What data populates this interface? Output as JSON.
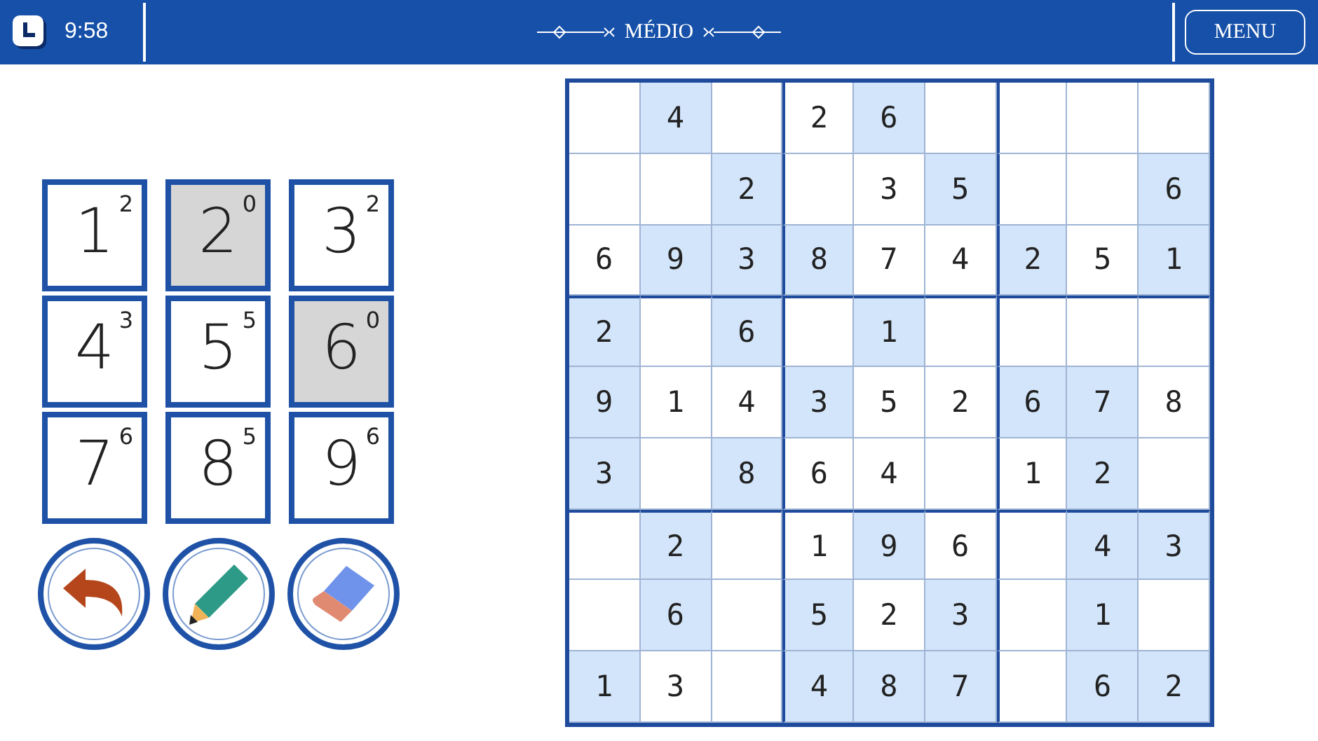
{
  "header": {
    "time": "9:58",
    "difficulty": "MÉDIO",
    "menu_button": "MENU"
  },
  "keypad": [
    {
      "digit": "1",
      "count": "2",
      "disabled": false
    },
    {
      "digit": "2",
      "count": "0",
      "disabled": true
    },
    {
      "digit": "3",
      "count": "2",
      "disabled": false
    },
    {
      "digit": "4",
      "count": "3",
      "disabled": false
    },
    {
      "digit": "5",
      "count": "5",
      "disabled": false
    },
    {
      "digit": "6",
      "count": "0",
      "disabled": true
    },
    {
      "digit": "7",
      "count": "6",
      "disabled": false
    },
    {
      "digit": "8",
      "count": "5",
      "disabled": false
    },
    {
      "digit": "9",
      "count": "6",
      "disabled": false
    }
  ],
  "tools": [
    {
      "kind": "undo"
    },
    {
      "kind": "pencil"
    },
    {
      "kind": "eraser"
    }
  ],
  "grid": [
    [
      {
        "shaded": false
      },
      {
        "value": "4",
        "shaded": true
      },
      {
        "shaded": false
      },
      {
        "value": "2",
        "shaded": false
      },
      {
        "value": "6",
        "shaded": true
      },
      {
        "shaded": false
      },
      {
        "shaded": false
      },
      {
        "shaded": false
      },
      {
        "shaded": false
      }
    ],
    [
      {
        "shaded": false
      },
      {
        "shaded": false
      },
      {
        "value": "2",
        "shaded": true
      },
      {
        "shaded": false
      },
      {
        "value": "3",
        "shaded": false
      },
      {
        "value": "5",
        "shaded": true
      },
      {
        "shaded": false
      },
      {
        "shaded": false
      },
      {
        "value": "6",
        "shaded": true
      }
    ],
    [
      {
        "value": "6",
        "shaded": false
      },
      {
        "value": "9",
        "shaded": true
      },
      {
        "value": "3",
        "shaded": true
      },
      {
        "value": "8",
        "shaded": true
      },
      {
        "value": "7",
        "shaded": false
      },
      {
        "value": "4",
        "shaded": false
      },
      {
        "value": "2",
        "shaded": true
      },
      {
        "value": "5",
        "shaded": false
      },
      {
        "value": "1",
        "shaded": true
      }
    ],
    [
      {
        "value": "2",
        "shaded": true
      },
      {
        "shaded": false
      },
      {
        "value": "6",
        "shaded": true
      },
      {
        "shaded": false
      },
      {
        "value": "1",
        "shaded": true
      },
      {
        "shaded": false
      },
      {
        "shaded": false
      },
      {
        "shaded": false
      },
      {
        "shaded": false
      }
    ],
    [
      {
        "value": "9",
        "shaded": true
      },
      {
        "value": "1",
        "shaded": false
      },
      {
        "value": "4",
        "shaded": false
      },
      {
        "value": "3",
        "shaded": true
      },
      {
        "value": "5",
        "shaded": false
      },
      {
        "value": "2",
        "shaded": false
      },
      {
        "value": "6",
        "shaded": true
      },
      {
        "value": "7",
        "shaded": true
      },
      {
        "value": "8",
        "shaded": false
      }
    ],
    [
      {
        "value": "3",
        "shaded": true
      },
      {
        "shaded": false
      },
      {
        "value": "8",
        "shaded": true
      },
      {
        "value": "6",
        "shaded": false
      },
      {
        "value": "4",
        "shaded": false
      },
      {
        "shaded": false
      },
      {
        "value": "1",
        "shaded": false
      },
      {
        "value": "2",
        "shaded": true
      },
      {
        "shaded": false
      }
    ],
    [
      {
        "shaded": false
      },
      {
        "value": "2",
        "shaded": true
      },
      {
        "shaded": false
      },
      {
        "value": "1",
        "shaded": false
      },
      {
        "value": "9",
        "shaded": true
      },
      {
        "value": "6",
        "shaded": false
      },
      {
        "shaded": false
      },
      {
        "value": "4",
        "shaded": true
      },
      {
        "value": "3",
        "shaded": true
      }
    ],
    [
      {
        "shaded": false
      },
      {
        "value": "6",
        "shaded": true
      },
      {
        "shaded": false
      },
      {
        "value": "5",
        "shaded": true
      },
      {
        "value": "2",
        "shaded": false
      },
      {
        "value": "3",
        "shaded": true
      },
      {
        "shaded": false
      },
      {
        "value": "1",
        "shaded": true
      },
      {
        "shaded": false
      }
    ],
    [
      {
        "value": "1",
        "shaded": true
      },
      {
        "value": "3",
        "shaded": false
      },
      {
        "shaded": false
      },
      {
        "value": "4",
        "shaded": true
      },
      {
        "value": "8",
        "shaded": true
      },
      {
        "value": "7",
        "shaded": true
      },
      {
        "shaded": false
      },
      {
        "value": "6",
        "shaded": true
      },
      {
        "value": "2",
        "shaded": true
      }
    ]
  ]
}
